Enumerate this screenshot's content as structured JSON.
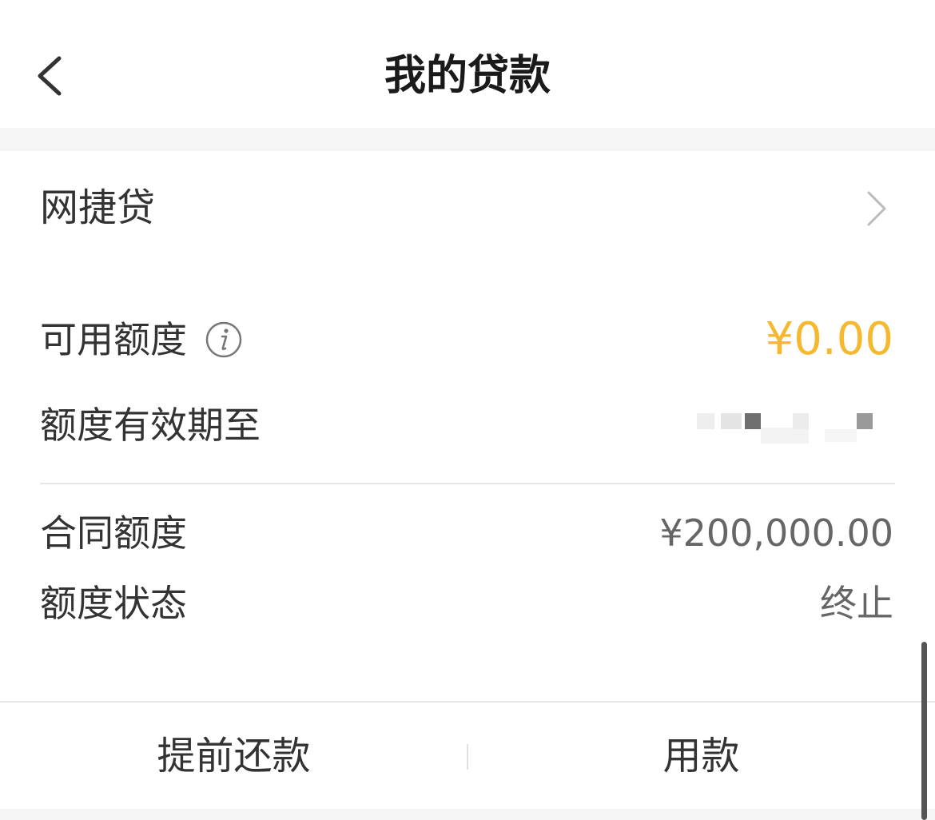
{
  "header": {
    "title": "我的贷款",
    "back_icon": "chevron-left-icon"
  },
  "product": {
    "name": "网捷贷",
    "chevron_icon": "chevron-right-icon"
  },
  "credit": {
    "available_label": "可用额度",
    "available_value": "¥0.00",
    "available_color": "#f5b82e",
    "info_icon": "info-icon",
    "expiry_label": "额度有效期至",
    "contract_label": "合同额度",
    "contract_value": "¥200,000.00",
    "status_label": "额度状态",
    "status_value": "终止"
  },
  "actions": {
    "prepay_label": "提前还款",
    "borrow_label": "用款"
  }
}
